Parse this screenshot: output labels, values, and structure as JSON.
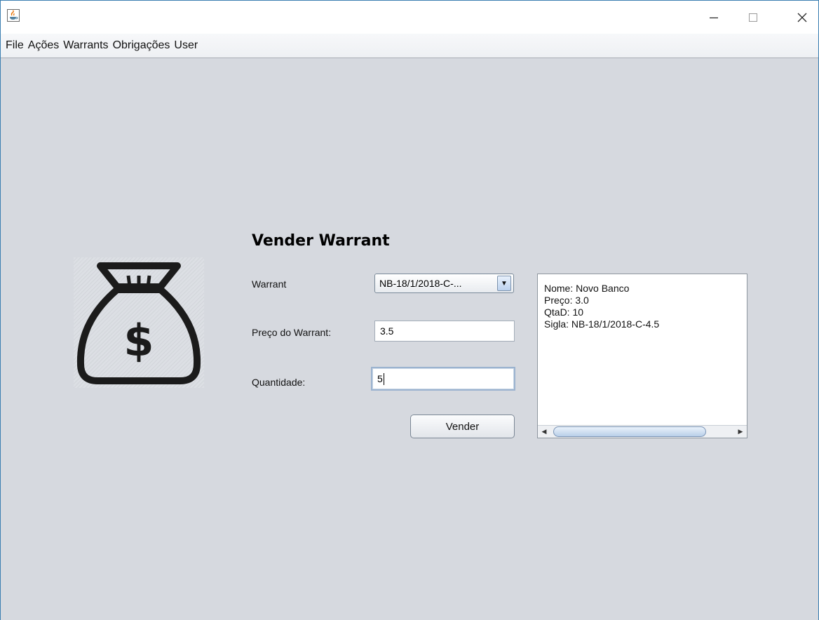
{
  "window": {
    "controls": {
      "minimize": "—",
      "maximize": "☐",
      "close": "✕"
    }
  },
  "menu": [
    "File",
    "Ações",
    "Warrants",
    "Obrigações",
    "User"
  ],
  "form": {
    "title": "Vender Warrant",
    "warrant_label": "Warrant",
    "warrant_selected": "NB-18/1/2018-C-...",
    "preco_label": "Preço do Warrant:",
    "preco_value": "3.5",
    "quantidade_label": "Quantidade:",
    "quantidade_value": "5",
    "submit_label": "Vender"
  },
  "info": {
    "lines": [
      "Nome: Novo Banco",
      "Preço: 3.0",
      "QtaD: 10",
      "Sigla: NB-18/1/2018-C-4.5"
    ]
  },
  "icons": {
    "app": "java-cup-icon",
    "illustration": "money-bag-icon"
  },
  "colors": {
    "background": "#d6d9df",
    "window_border": "#3c7fb1"
  }
}
